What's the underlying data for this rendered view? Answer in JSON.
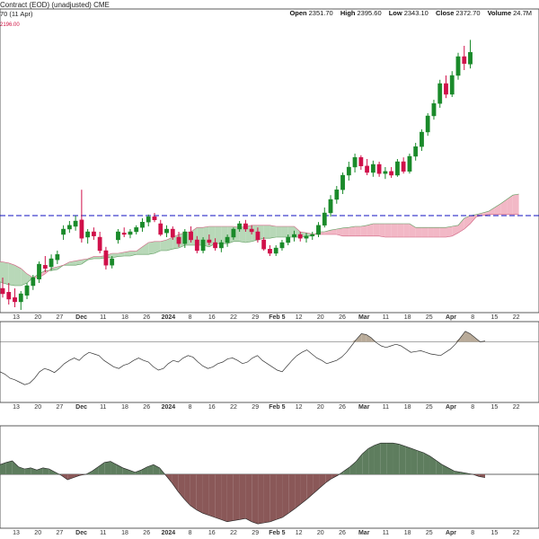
{
  "header": {
    "title": "Contract (EOD) (unadjusted)",
    "exchange": "CME",
    "subtitle": "70 (11 Apr)",
    "subvalue": "2196.00",
    "ohlc": [
      {
        "label": "Open",
        "value": "2351.70"
      },
      {
        "label": "High",
        "value": "2395.60"
      },
      {
        "label": "Low",
        "value": "2343.10"
      },
      {
        "label": "Close",
        "value": "2372.70"
      },
      {
        "label": "Volume",
        "value": "24.7M"
      }
    ]
  },
  "colors": {
    "up": "#1a8a2a",
    "down": "#d0104a",
    "cloud_bull": "#b8d8b8",
    "cloud_bear": "#f2b8c6",
    "hline": "#1010c0",
    "osc_pos": "#5e7d5e",
    "osc_neg": "#8a5858"
  },
  "x_ticks": [
    "13",
    "20",
    "27",
    "Dec",
    "11",
    "18",
    "26",
    "2024",
    "8",
    "16",
    "22",
    "29",
    "Feb 5",
    "12",
    "20",
    "26",
    "Mar",
    "11",
    "18",
    "25",
    "Apr",
    "8",
    "15",
    "22"
  ],
  "chart_data": [
    {
      "type": "candlestick",
      "hline": 2070,
      "ylim": [
        1890,
        2440
      ],
      "candles": [
        {
          "o": 1935,
          "h": 1955,
          "l": 1918,
          "c": 1925
        },
        {
          "o": 1928,
          "h": 1945,
          "l": 1905,
          "c": 1915
        },
        {
          "o": 1918,
          "h": 1935,
          "l": 1900,
          "c": 1910
        },
        {
          "o": 1910,
          "h": 1930,
          "l": 1895,
          "c": 1925
        },
        {
          "o": 1922,
          "h": 1945,
          "l": 1915,
          "c": 1940
        },
        {
          "o": 1940,
          "h": 1960,
          "l": 1932,
          "c": 1955
        },
        {
          "o": 1952,
          "h": 1985,
          "l": 1945,
          "c": 1980
        },
        {
          "o": 1978,
          "h": 1995,
          "l": 1965,
          "c": 1972
        },
        {
          "o": 1975,
          "h": 1998,
          "l": 1968,
          "c": 1990
        },
        {
          "o": 1988,
          "h": 2005,
          "l": 1980,
          "c": 1998
        },
        {
          "o": 2035,
          "h": 2052,
          "l": 2025,
          "c": 2045
        },
        {
          "o": 2045,
          "h": 2060,
          "l": 2038,
          "c": 2052
        },
        {
          "o": 2050,
          "h": 2070,
          "l": 2042,
          "c": 2060
        },
        {
          "o": 2062,
          "h": 2118,
          "l": 2020,
          "c": 2028
        },
        {
          "o": 2030,
          "h": 2045,
          "l": 2018,
          "c": 2040
        },
        {
          "o": 2040,
          "h": 2048,
          "l": 2025,
          "c": 2032
        },
        {
          "o": 2030,
          "h": 2040,
          "l": 2000,
          "c": 2005
        },
        {
          "o": 2005,
          "h": 2012,
          "l": 1970,
          "c": 1978
        },
        {
          "o": 1978,
          "h": 1995,
          "l": 1972,
          "c": 1990
        },
        {
          "o": 2025,
          "h": 2045,
          "l": 2018,
          "c": 2040
        },
        {
          "o": 2038,
          "h": 2048,
          "l": 2030,
          "c": 2035
        },
        {
          "o": 2035,
          "h": 2045,
          "l": 2028,
          "c": 2040
        },
        {
          "o": 2040,
          "h": 2052,
          "l": 2035,
          "c": 2048
        },
        {
          "o": 2048,
          "h": 2065,
          "l": 2040,
          "c": 2058
        },
        {
          "o": 2058,
          "h": 2072,
          "l": 2050,
          "c": 2068
        },
        {
          "o": 2068,
          "h": 2075,
          "l": 2058,
          "c": 2062
        },
        {
          "o": 2055,
          "h": 2062,
          "l": 2032,
          "c": 2035
        },
        {
          "o": 2038,
          "h": 2052,
          "l": 2030,
          "c": 2045
        },
        {
          "o": 2045,
          "h": 2050,
          "l": 2025,
          "c": 2030
        },
        {
          "o": 2030,
          "h": 2040,
          "l": 2012,
          "c": 2018
        },
        {
          "o": 2018,
          "h": 2045,
          "l": 2010,
          "c": 2040
        },
        {
          "o": 2040,
          "h": 2050,
          "l": 2020,
          "c": 2025
        },
        {
          "o": 2025,
          "h": 2032,
          "l": 2000,
          "c": 2005
        },
        {
          "o": 2005,
          "h": 2030,
          "l": 2000,
          "c": 2025
        },
        {
          "o": 2025,
          "h": 2035,
          "l": 2015,
          "c": 2020
        },
        {
          "o": 2020,
          "h": 2028,
          "l": 2005,
          "c": 2010
        },
        {
          "o": 2010,
          "h": 2025,
          "l": 2002,
          "c": 2020
        },
        {
          "o": 2020,
          "h": 2035,
          "l": 2012,
          "c": 2030
        },
        {
          "o": 2030,
          "h": 2048,
          "l": 2025,
          "c": 2045
        },
        {
          "o": 2045,
          "h": 2060,
          "l": 2040,
          "c": 2055
        },
        {
          "o": 2055,
          "h": 2062,
          "l": 2040,
          "c": 2045
        },
        {
          "o": 2045,
          "h": 2052,
          "l": 2035,
          "c": 2040
        },
        {
          "o": 2040,
          "h": 2048,
          "l": 2020,
          "c": 2025
        },
        {
          "o": 2025,
          "h": 2030,
          "l": 2005,
          "c": 2008
        },
        {
          "o": 2008,
          "h": 2015,
          "l": 1995,
          "c": 2000
        },
        {
          "o": 2000,
          "h": 2015,
          "l": 1995,
          "c": 2010
        },
        {
          "o": 2010,
          "h": 2025,
          "l": 2005,
          "c": 2020
        },
        {
          "o": 2020,
          "h": 2035,
          "l": 2015,
          "c": 2030
        },
        {
          "o": 2030,
          "h": 2042,
          "l": 2022,
          "c": 2035
        },
        {
          "o": 2035,
          "h": 2040,
          "l": 2022,
          "c": 2028
        },
        {
          "o": 2028,
          "h": 2038,
          "l": 2020,
          "c": 2032
        },
        {
          "o": 2032,
          "h": 2040,
          "l": 2025,
          "c": 2035
        },
        {
          "o": 2035,
          "h": 2058,
          "l": 2030,
          "c": 2052
        },
        {
          "o": 2052,
          "h": 2085,
          "l": 2048,
          "c": 2075
        },
        {
          "o": 2075,
          "h": 2108,
          "l": 2068,
          "c": 2100
        },
        {
          "o": 2100,
          "h": 2125,
          "l": 2092,
          "c": 2118
        },
        {
          "o": 2118,
          "h": 2150,
          "l": 2110,
          "c": 2145
        },
        {
          "o": 2145,
          "h": 2170,
          "l": 2135,
          "c": 2160
        },
        {
          "o": 2160,
          "h": 2185,
          "l": 2150,
          "c": 2178
        },
        {
          "o": 2178,
          "h": 2182,
          "l": 2155,
          "c": 2162
        },
        {
          "o": 2162,
          "h": 2175,
          "l": 2145,
          "c": 2150
        },
        {
          "o": 2150,
          "h": 2172,
          "l": 2142,
          "c": 2165
        },
        {
          "o": 2165,
          "h": 2170,
          "l": 2142,
          "c": 2148
        },
        {
          "o": 2148,
          "h": 2160,
          "l": 2138,
          "c": 2152
        },
        {
          "o": 2152,
          "h": 2160,
          "l": 2140,
          "c": 2145
        },
        {
          "o": 2145,
          "h": 2175,
          "l": 2142,
          "c": 2170
        },
        {
          "o": 2170,
          "h": 2178,
          "l": 2148,
          "c": 2152
        },
        {
          "o": 2152,
          "h": 2185,
          "l": 2148,
          "c": 2180
        },
        {
          "o": 2180,
          "h": 2205,
          "l": 2172,
          "c": 2198
        },
        {
          "o": 2198,
          "h": 2230,
          "l": 2190,
          "c": 2225
        },
        {
          "o": 2225,
          "h": 2260,
          "l": 2218,
          "c": 2255
        },
        {
          "o": 2255,
          "h": 2285,
          "l": 2248,
          "c": 2278
        },
        {
          "o": 2278,
          "h": 2322,
          "l": 2270,
          "c": 2315
        },
        {
          "o": 2315,
          "h": 2330,
          "l": 2288,
          "c": 2295
        },
        {
          "o": 2295,
          "h": 2338,
          "l": 2290,
          "c": 2330
        },
        {
          "o": 2330,
          "h": 2372,
          "l": 2322,
          "c": 2365
        },
        {
          "o": 2365,
          "h": 2385,
          "l": 2340,
          "c": 2352
        },
        {
          "o": 2351,
          "h": 2396,
          "l": 2343,
          "c": 2373
        }
      ],
      "cloud": [
        [
          1955,
          1985
        ],
        [
          1950,
          1985
        ],
        [
          1945,
          1984
        ],
        [
          1942,
          1982
        ],
        [
          1940,
          1978
        ],
        [
          1940,
          1972
        ],
        [
          1945,
          1962
        ],
        [
          1955,
          1955
        ],
        [
          1962,
          1955
        ],
        [
          1968,
          1962
        ],
        [
          1968,
          1972
        ],
        [
          1970,
          1975
        ],
        [
          1978,
          1978
        ],
        [
          1978,
          1984
        ],
        [
          1978,
          1986
        ],
        [
          1980,
          1988
        ],
        [
          1988,
          1990
        ],
        [
          1990,
          1994
        ],
        [
          1990,
          1994
        ],
        [
          1992,
          1996
        ],
        [
          1992,
          2000
        ],
        [
          1994,
          2000
        ],
        [
          1995,
          2002
        ],
        [
          1995,
          2004
        ],
        [
          1998,
          2004
        ],
        [
          1998,
          2012
        ],
        [
          1998,
          2020
        ],
        [
          2000,
          2022
        ],
        [
          2005,
          2022
        ],
        [
          2005,
          2025
        ],
        [
          2008,
          2030
        ],
        [
          2010,
          2035
        ],
        [
          2015,
          2038
        ],
        [
          2015,
          2040
        ],
        [
          2015,
          2048
        ],
        [
          2015,
          2048
        ],
        [
          2012,
          2050
        ],
        [
          2018,
          2050
        ],
        [
          2018,
          2050
        ],
        [
          2018,
          2050
        ],
        [
          2022,
          2050
        ],
        [
          2022,
          2048
        ],
        [
          2020,
          2050
        ],
        [
          2022,
          2052
        ],
        [
          2025,
          2052
        ],
        [
          2028,
          2052
        ],
        [
          2028,
          2052
        ],
        [
          2030,
          2050
        ],
        [
          2030,
          2050
        ],
        [
          2030,
          2050
        ],
        [
          2030,
          2050
        ],
        [
          2030,
          2040
        ],
        [
          2032,
          2038
        ],
        [
          2032,
          2036
        ],
        [
          2040,
          2035
        ],
        [
          2040,
          2035
        ],
        [
          2043,
          2035
        ],
        [
          2045,
          2035
        ],
        [
          2047,
          2032
        ],
        [
          2048,
          2032
        ],
        [
          2050,
          2032
        ],
        [
          2050,
          2032
        ],
        [
          2052,
          2032
        ],
        [
          2055,
          2032
        ],
        [
          2055,
          2032
        ],
        [
          2055,
          2030
        ],
        [
          2055,
          2030
        ],
        [
          2055,
          2030
        ],
        [
          2055,
          2030
        ],
        [
          2055,
          2030
        ],
        [
          2048,
          2030
        ],
        [
          2048,
          2030
        ],
        [
          2048,
          2030
        ],
        [
          2048,
          2030
        ],
        [
          2048,
          2030
        ],
        [
          2048,
          2030
        ],
        [
          2050,
          2032
        ],
        [
          2052,
          2038
        ],
        [
          2065,
          2045
        ],
        [
          2070,
          2055
        ],
        [
          2072,
          2068
        ],
        [
          2075,
          2070
        ],
        [
          2078,
          2072
        ],
        [
          2085,
          2072
        ],
        [
          2092,
          2072
        ],
        [
          2100,
          2072
        ],
        [
          2108,
          2072
        ],
        [
          2110,
          2072
        ]
      ],
      "cloud_future_offset": 0
    },
    {
      "type": "line",
      "ylim": [
        0,
        100
      ],
      "levels": [
        75
      ],
      "values": [
        38,
        35,
        30,
        28,
        25,
        22,
        24,
        30,
        38,
        42,
        40,
        37,
        42,
        48,
        52,
        55,
        52,
        58,
        62,
        60,
        58,
        52,
        48,
        44,
        42,
        46,
        48,
        52,
        55,
        52,
        50,
        44,
        40,
        42,
        48,
        52,
        50,
        55,
        58,
        56,
        50,
        45,
        42,
        44,
        48,
        50,
        54,
        55,
        52,
        48,
        50,
        55,
        58,
        52,
        48,
        44,
        40,
        38,
        45,
        52,
        58,
        62,
        65,
        60,
        55,
        52,
        48,
        50,
        52,
        56,
        62,
        70,
        78,
        85,
        84,
        80,
        74,
        70,
        68,
        70,
        72,
        70,
        66,
        62,
        63,
        64,
        62,
        60,
        59,
        58,
        62,
        66,
        72,
        80,
        88,
        85,
        80,
        75,
        76
      ]
    },
    {
      "type": "area",
      "ylim": [
        -100,
        90
      ],
      "zero": 0,
      "values": [
        18,
        22,
        25,
        14,
        10,
        12,
        8,
        12,
        10,
        4,
        -2,
        -10,
        -6,
        -2,
        0,
        6,
        14,
        22,
        24,
        18,
        12,
        8,
        4,
        8,
        14,
        18,
        12,
        -2,
        -16,
        -32,
        -46,
        -58,
        -66,
        -72,
        -76,
        -80,
        -84,
        -88,
        -86,
        -84,
        -82,
        -88,
        -92,
        -90,
        -88,
        -84,
        -80,
        -72,
        -64,
        -55,
        -46,
        -36,
        -26,
        -16,
        -8,
        -2,
        6,
        14,
        24,
        38,
        48,
        54,
        58,
        58,
        58,
        56,
        52,
        48,
        44,
        40,
        34,
        26,
        18,
        12,
        6,
        4,
        2,
        0,
        -4,
        -6
      ]
    }
  ]
}
